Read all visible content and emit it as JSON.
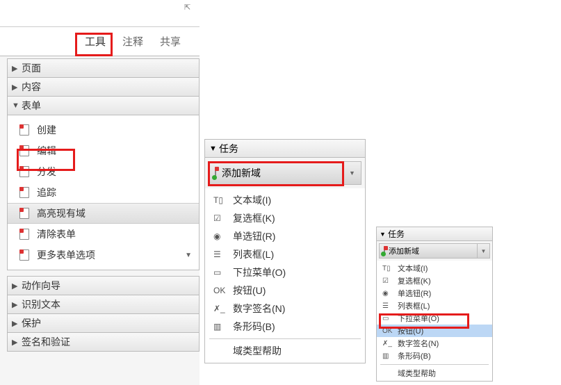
{
  "tabs": {
    "tools": "工具",
    "comments": "注释",
    "share": "共享"
  },
  "sections": {
    "page": "页面",
    "content": "内容",
    "form": "表单",
    "action_wizard": "动作向导",
    "recognize_text": "识别文本",
    "protect": "保护",
    "sign_cert": "签名和验证"
  },
  "form_items": {
    "create": "创建",
    "edit": "编辑",
    "distribute": "分发",
    "track": "追踪",
    "highlight": "高亮现有域",
    "clear": "清除表单",
    "more": "更多表单选项"
  },
  "task": {
    "title": "任务",
    "add_field": "添加新域",
    "text_field": "文本域",
    "text_field_k": "(I)",
    "checkbox": "复选框",
    "checkbox_k": "(K)",
    "radio": "单选钮",
    "radio_k": "(R)",
    "listbox": "列表框",
    "listbox_k": "(L)",
    "dropdown": "下拉菜单",
    "dropdown_k": "(O)",
    "button": "按钮",
    "button_k": "(U)",
    "signature": "数字签名",
    "signature_k": "(N)",
    "barcode": "条形码",
    "barcode_k": "(B)",
    "help": "域类型帮助"
  }
}
